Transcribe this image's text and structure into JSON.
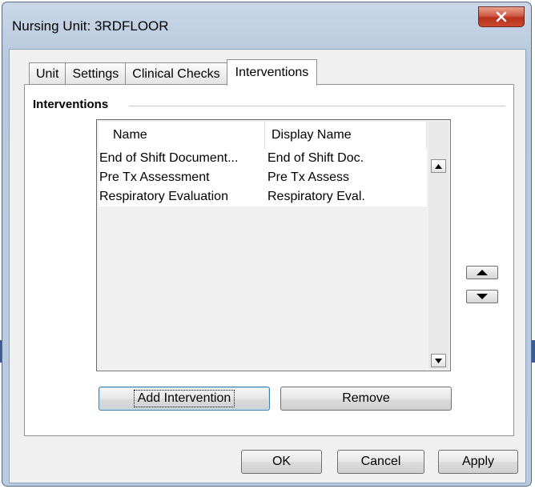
{
  "window": {
    "title": "Nursing Unit: 3RDFLOOR"
  },
  "tabs": [
    {
      "label": "Unit"
    },
    {
      "label": "Settings"
    },
    {
      "label": "Clinical Checks"
    },
    {
      "label": "Interventions",
      "selected": true
    }
  ],
  "interventions": {
    "group_title": "Interventions",
    "columns": {
      "name": "Name",
      "display_name": "Display Name"
    },
    "rows": [
      {
        "name": "End of Shift Document...",
        "display_name": "End of Shift Doc."
      },
      {
        "name": "Pre Tx Assessment",
        "display_name": "Pre Tx Assess"
      },
      {
        "name": "Respiratory Evaluation",
        "display_name": "Respiratory Eval."
      }
    ],
    "add_button": "Add Intervention",
    "remove_button": "Remove"
  },
  "footer": {
    "ok": "OK",
    "cancel": "Cancel",
    "apply": "Apply"
  },
  "icons": {
    "close": "close-icon",
    "scroll_up": "scroll-up-arrow-icon",
    "scroll_down": "scroll-down-arrow-icon",
    "move_up": "move-up-arrow-icon",
    "move_down": "move-down-arrow-icon"
  },
  "colors": {
    "close_button": "#c9472f",
    "frame": "#b9cbe0",
    "focus_border": "#3c7fb1"
  }
}
